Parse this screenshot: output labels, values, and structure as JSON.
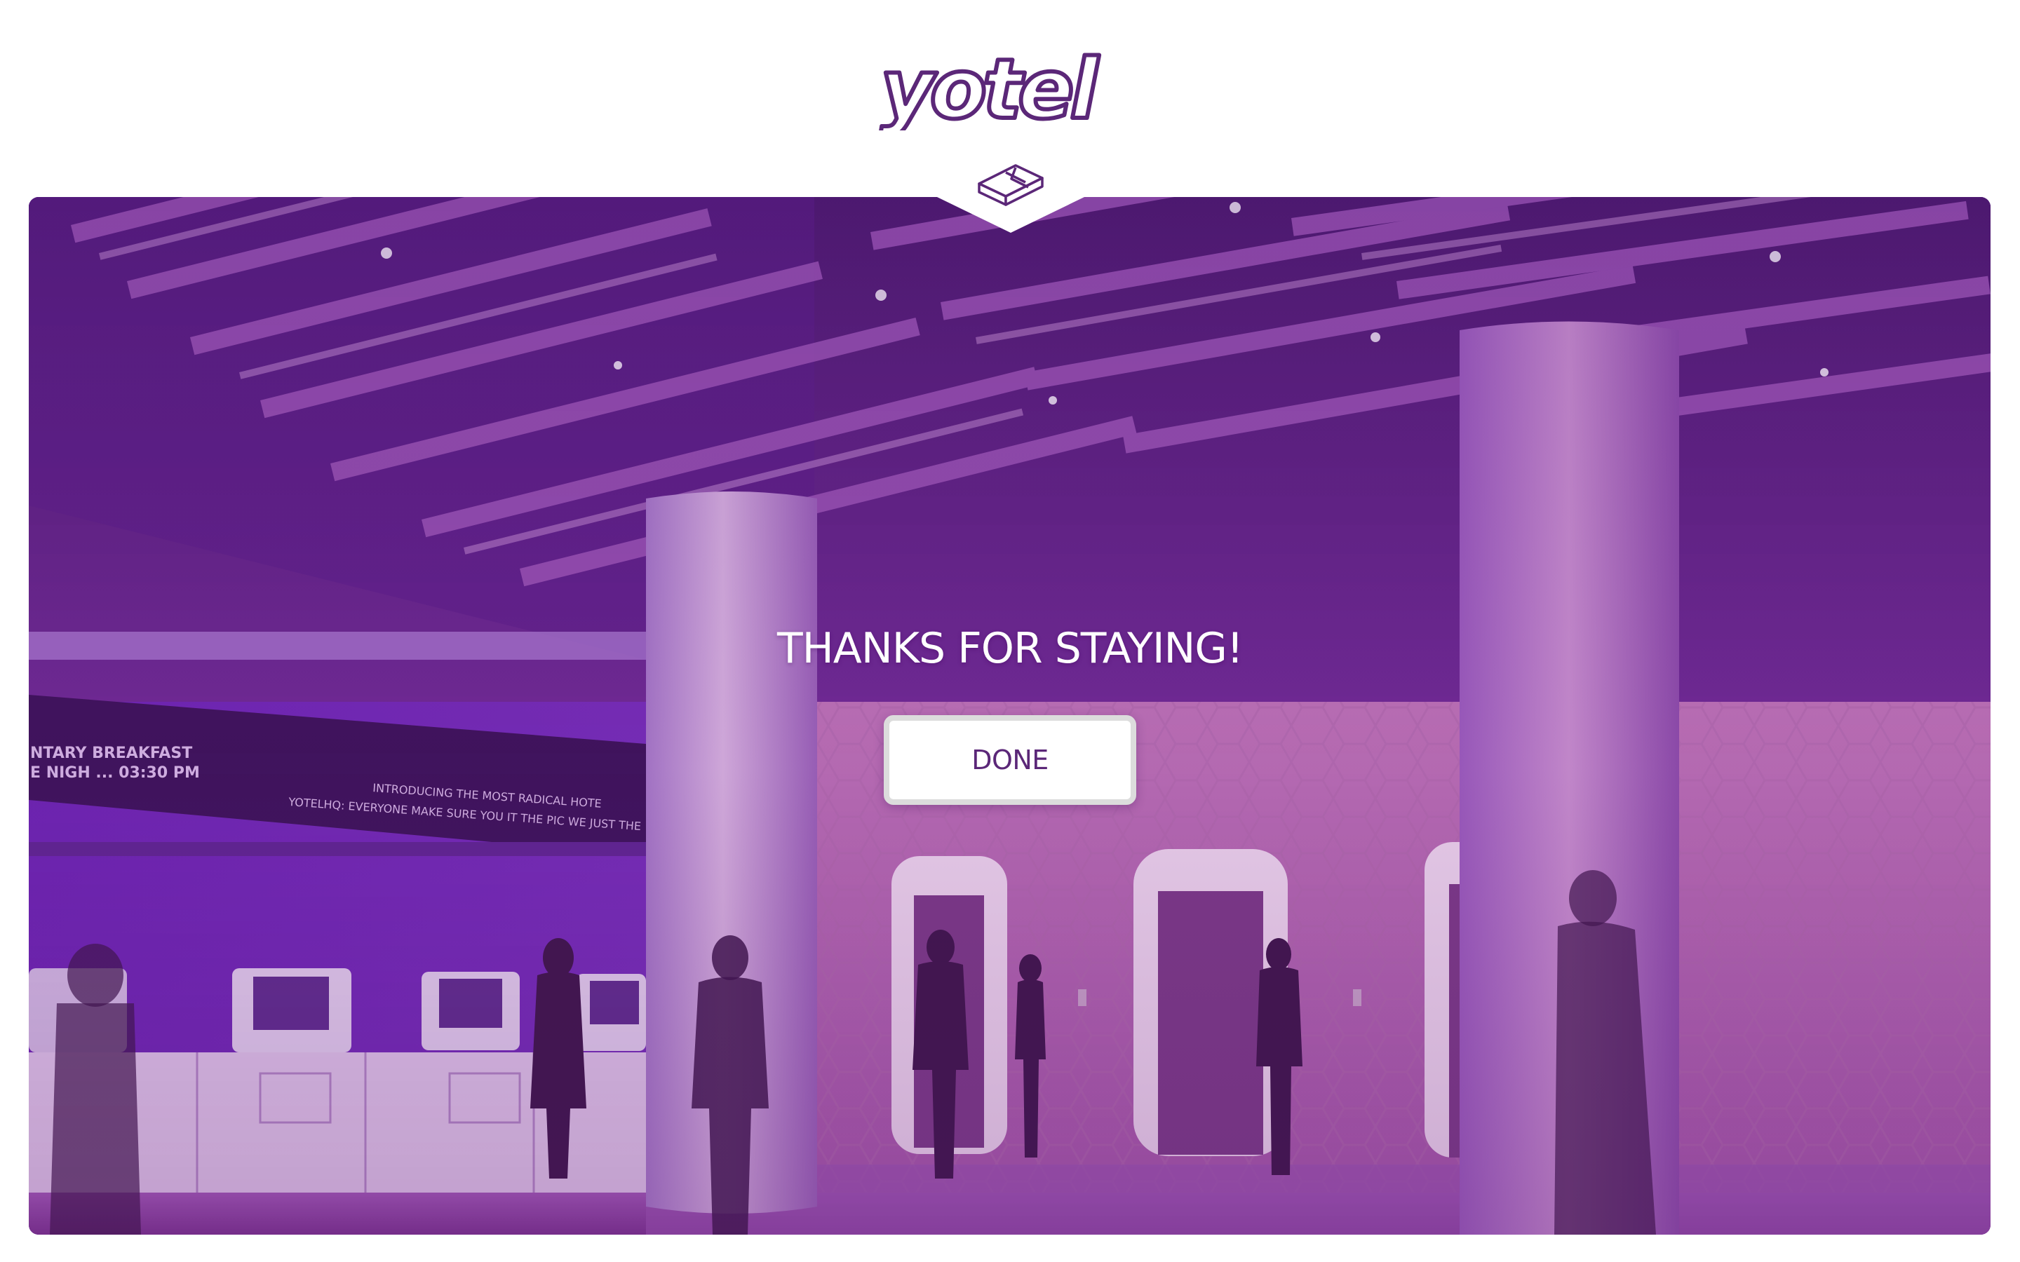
{
  "brand": {
    "name": "yotel",
    "logo_icon": "yotel-logo",
    "badge_icon": "room-key-icon",
    "primary_color": "#5b2778",
    "accent_color": "#8a3fb8"
  },
  "hero": {
    "image": "hotel-lobby-photo",
    "signage_line_1": "NTARY BREAKFAST",
    "signage_line_2": "E NIGH ...   03:30 PM",
    "signage_line_3": "INTRODUCING THE MOST RADICAL HOTE",
    "signage_line_4": "YOTELHQ: EVERYONE MAKE SURE YOU IT THE PIC WE JUST THE"
  },
  "main": {
    "title": "THANKS FOR STAYING!",
    "done_label": "DONE"
  }
}
